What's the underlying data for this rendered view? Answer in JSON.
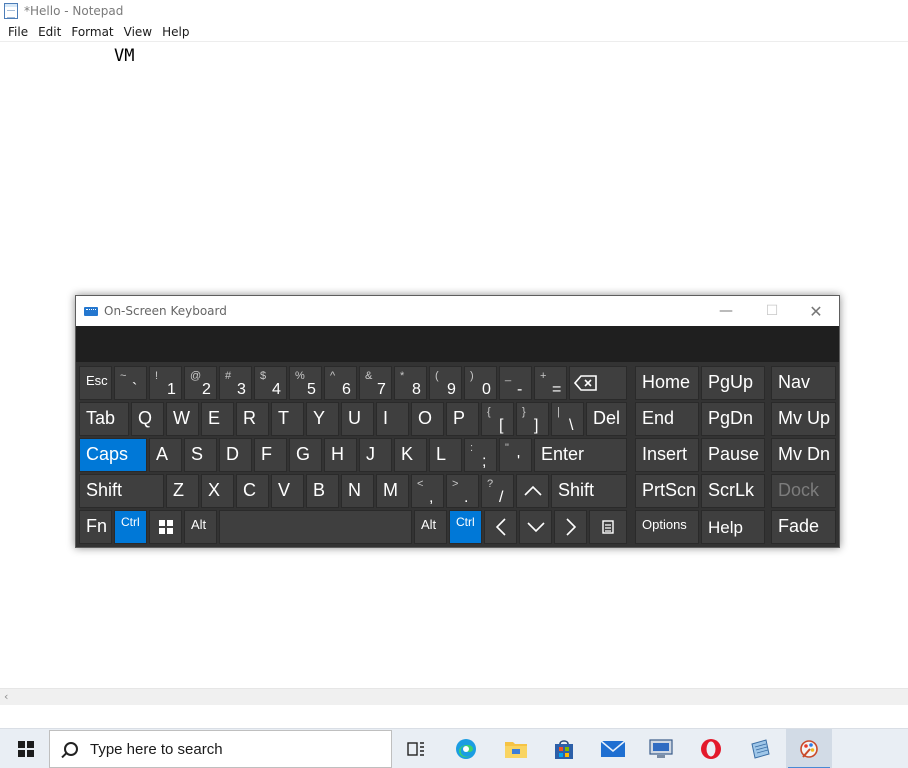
{
  "notepad": {
    "title": "*Hello - Notepad",
    "menu": [
      "File",
      "Edit",
      "Format",
      "View",
      "Help"
    ],
    "content": "VM"
  },
  "osk": {
    "title": "On-Screen Keyboard",
    "controls": {
      "minimize": "—",
      "maximize": "☐",
      "close": "✕"
    },
    "keys": {
      "esc": "Esc",
      "n1": {
        "shift": "!",
        "main": "1"
      },
      "n2": {
        "shift": "@",
        "main": "2"
      },
      "n3": {
        "shift": "#",
        "main": "3"
      },
      "n4": {
        "shift": "$",
        "main": "4"
      },
      "n5": {
        "shift": "%",
        "main": "5"
      },
      "n6": {
        "shift": "^",
        "main": "6"
      },
      "n7": {
        "shift": "&",
        "main": "7"
      },
      "n8": {
        "shift": "*",
        "main": "8"
      },
      "n9": {
        "shift": "(",
        "main": "9"
      },
      "n0": {
        "shift": ")",
        "main": "0"
      },
      "tilde": {
        "shift": "~",
        "main": "`"
      },
      "minus": {
        "shift": "_",
        "main": "-"
      },
      "equals": {
        "shift": "+",
        "main": "="
      },
      "lbracket": {
        "shift": "{",
        "main": "["
      },
      "rbracket": {
        "shift": "}",
        "main": "]"
      },
      "backslash": {
        "shift": "|",
        "main": "\\"
      },
      "semicolon": {
        "shift": ":",
        "main": ";"
      },
      "quote": {
        "shift": "\"",
        "main": "'"
      },
      "comma": {
        "shift": "<",
        "main": ","
      },
      "period": {
        "shift": ">",
        "main": "."
      },
      "slash": {
        "shift": "?",
        "main": "/"
      },
      "tab": "Tab",
      "q": "Q",
      "w": "W",
      "e": "E",
      "r": "R",
      "t": "T",
      "y": "Y",
      "u": "U",
      "i": "I",
      "o": "O",
      "p": "P",
      "del": "Del",
      "caps": "Caps",
      "a": "A",
      "s": "S",
      "d": "D",
      "f": "F",
      "g": "G",
      "h": "H",
      "j": "J",
      "k": "K",
      "l": "L",
      "enter": "Enter",
      "shift": "Shift",
      "z": "Z",
      "x": "X",
      "c": "C",
      "v": "V",
      "b": "B",
      "n": "N",
      "m": "M",
      "fn": "Fn",
      "ctrl": "Ctrl",
      "alt": "Alt",
      "home": "Home",
      "pgup": "PgUp",
      "nav": "Nav",
      "end": "End",
      "pgdn": "PgDn",
      "mvup": "Mv Up",
      "insert": "Insert",
      "pause": "Pause",
      "mvdn": "Mv Dn",
      "prtscn": "PrtScn",
      "scrlk": "ScrLk",
      "dock": "Dock",
      "options": "Options",
      "help": "Help",
      "fade": "Fade"
    },
    "active_keys": [
      "caps",
      "ctrl-left",
      "ctrl-right"
    ],
    "accent_color": "#0078d7"
  },
  "taskbar": {
    "search_placeholder": "Type here to search",
    "pinned": [
      "task-view",
      "edge",
      "file-explorer",
      "microsoft-store",
      "mail",
      "remote-desktop",
      "opera",
      "notepad",
      "paint"
    ]
  }
}
